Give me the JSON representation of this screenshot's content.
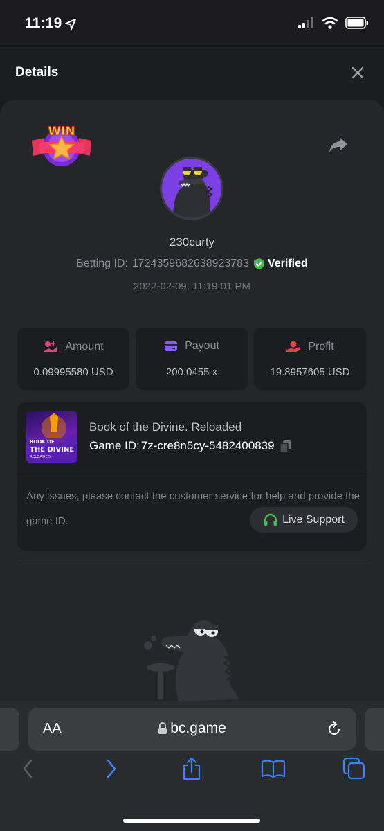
{
  "status_bar": {
    "time": "11:19"
  },
  "header": {
    "title": "Details"
  },
  "bet": {
    "username": "230curty",
    "betting_id_label": "Betting ID:",
    "betting_id": "1724359682638923783",
    "verified_label": "Verified",
    "timestamp": "2022-02-09, 11:19:01 PM"
  },
  "stats": [
    {
      "label": "Amount",
      "value": "0.09995580 USD"
    },
    {
      "label": "Payout",
      "value": "200.0455 x"
    },
    {
      "label": "Profit",
      "value": "19.8957605 USD"
    }
  ],
  "game": {
    "name": "Book of the Divine. Reloaded",
    "game_id_label": "Game ID:",
    "game_id": "7z-cre8n5cy-5482400839",
    "thumb_title_top": "BOOK OF",
    "thumb_title": "THE DIVINE",
    "thumb_sub": "RELOADED",
    "issue_text": "Any issues, please contact the customer service for help and provide the game ID.",
    "support_label": "Live Support"
  },
  "badge": {
    "text": "WIN"
  },
  "safari": {
    "aa_label": "AA",
    "url": "bc.game"
  },
  "colors": {
    "accent_purple": "#7b3fe4",
    "verified_green": "#3fb950",
    "safari_blue": "#3b82f6",
    "profit_red": "#e04848",
    "amount_pink": "#e0487a",
    "payout_purple": "#8b5cf6"
  }
}
